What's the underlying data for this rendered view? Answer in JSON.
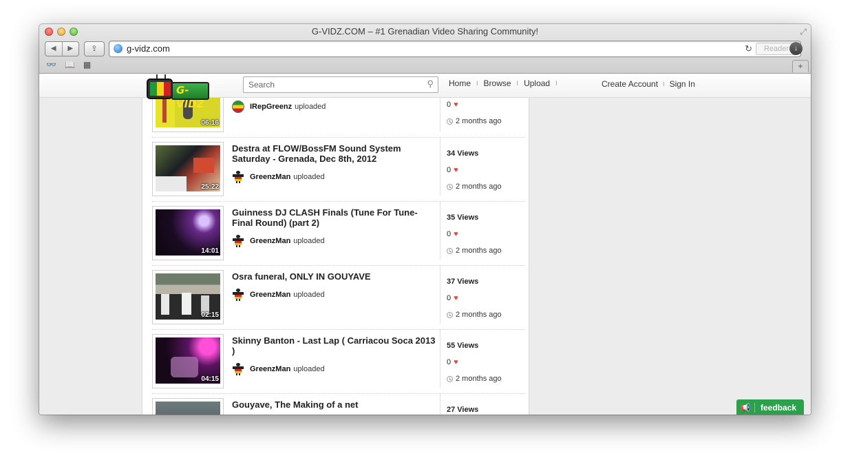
{
  "window": {
    "title": "G-VIDZ.COM – #1 Grenadian Video Sharing Community!"
  },
  "browser": {
    "url": "g-vidz.com",
    "reader_label": "Reader",
    "back_glyph": "◀",
    "forward_glyph": "▶",
    "share_glyph": "⇪",
    "reload_glyph": "↻",
    "newtab_glyph": "+",
    "download_glyph": "↓",
    "bookmarks": {
      "reading_list_glyph": "👓",
      "bookmarks_glyph": "📖",
      "topsites_glyph": "▦"
    },
    "fullscreen_glyph": "⤢"
  },
  "site": {
    "logo_text": "G-VIDZ",
    "search_placeholder": "Search",
    "search_glyph": "⚲",
    "nav": {
      "home": "Home",
      "browse": "Browse",
      "upload": "Upload",
      "sep": "I"
    },
    "account": {
      "create": "Create Account",
      "sign_in": "Sign In",
      "sep": "I"
    },
    "feedback_label": "feedback",
    "feedback_glyph": "📢"
  },
  "videos": [
    {
      "title": "",
      "duration": "06:16",
      "uploader": "IRepGreenz",
      "uploaded_label": "uploaded",
      "views": "",
      "likes": "0",
      "time": "2 months ago"
    },
    {
      "title": "Destra at FLOW/BossFM Sound System Saturday - Grenada, Dec 8th, 2012",
      "duration": "25:22",
      "uploader": "GreenzMan",
      "uploaded_label": "uploaded",
      "views": "34 Views",
      "likes": "0",
      "time": "2 months ago"
    },
    {
      "title": "Guinness DJ CLASH Finals (Tune For Tune- Final Round) (part 2)",
      "duration": "14:01",
      "uploader": "GreenzMan",
      "uploaded_label": "uploaded",
      "views": "35 Views",
      "likes": "0",
      "time": "2 months ago"
    },
    {
      "title": "Osra funeral, ONLY IN GOUYAVE",
      "duration": "02:15",
      "uploader": "GreenzMan",
      "uploaded_label": "uploaded",
      "views": "37 Views",
      "likes": "0",
      "time": "2 months ago"
    },
    {
      "title": "Skinny Banton - Last Lap ( Carriacou Soca 2013 )",
      "duration": "04:15",
      "uploader": "GreenzMan",
      "uploaded_label": "uploaded",
      "views": "55 Views",
      "likes": "0",
      "time": "2 months ago"
    },
    {
      "title": "Gouyave, The Making of a net",
      "duration": "",
      "uploader": "",
      "uploaded_label": "",
      "views": "27 Views",
      "likes": "",
      "time": ""
    }
  ],
  "heart_glyph": "♥",
  "colors": {
    "feedback": "#2aa14a",
    "heart": "#e2463c",
    "logo_green": "#1e7f2a",
    "logo_yellow": "#f6e31a"
  }
}
